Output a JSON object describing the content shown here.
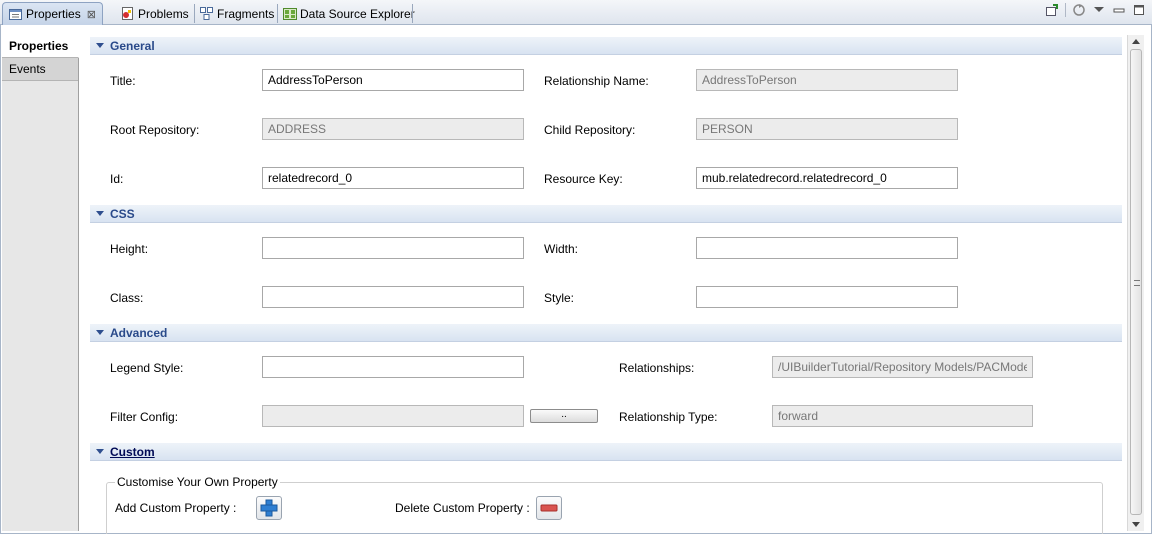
{
  "tabs": [
    {
      "label": "Properties",
      "icon": "properties-icon",
      "active": true
    },
    {
      "label": "Problems",
      "icon": "problems-icon"
    },
    {
      "label": "Fragments",
      "icon": "fragments-icon"
    },
    {
      "label": "Data Source Explorer",
      "icon": "data-source-explorer-icon"
    }
  ],
  "side_tabs": [
    {
      "label": "Properties",
      "active": true
    },
    {
      "label": "Events",
      "active": false
    }
  ],
  "sections": {
    "general": "General",
    "css": "CSS",
    "advanced": "Advanced",
    "custom": "Custom"
  },
  "general": {
    "title_label": "Title:",
    "title_value": "AddressToPerson",
    "relationship_name_label": "Relationship Name:",
    "relationship_name_value": "AddressToPerson",
    "root_repository_label": "Root Repository:",
    "root_repository_value": "ADDRESS",
    "child_repository_label": "Child Repository:",
    "child_repository_value": "PERSON",
    "id_label": "Id:",
    "id_value": "relatedrecord_0",
    "resource_key_label": "Resource Key:",
    "resource_key_value": "mub.relatedrecord.relatedrecord_0"
  },
  "css": {
    "height_label": "Height:",
    "height_value": "",
    "width_label": "Width:",
    "width_value": "",
    "class_label": "Class:",
    "class_value": "",
    "style_label": "Style:",
    "style_value": ""
  },
  "advanced": {
    "legend_style_label": "Legend Style:",
    "legend_style_value": "",
    "relationships_label": "Relationships:",
    "relationships_value": "/UIBuilderTutorial/Repository Models/PACModel",
    "filter_config_label": "Filter Config:",
    "filter_config_value": "",
    "browse_label": "..",
    "relationship_type_label": "Relationship Type:",
    "relationship_type_value": "forward"
  },
  "custom": {
    "group_title": "Customise Your Own Property",
    "add_label": "Add Custom Property :",
    "delete_label": "Delete Custom Property :"
  },
  "colors": {
    "section_title": "#2a4a8a",
    "add_icon": "#2f7fd2",
    "delete_icon": "#d9534f"
  }
}
